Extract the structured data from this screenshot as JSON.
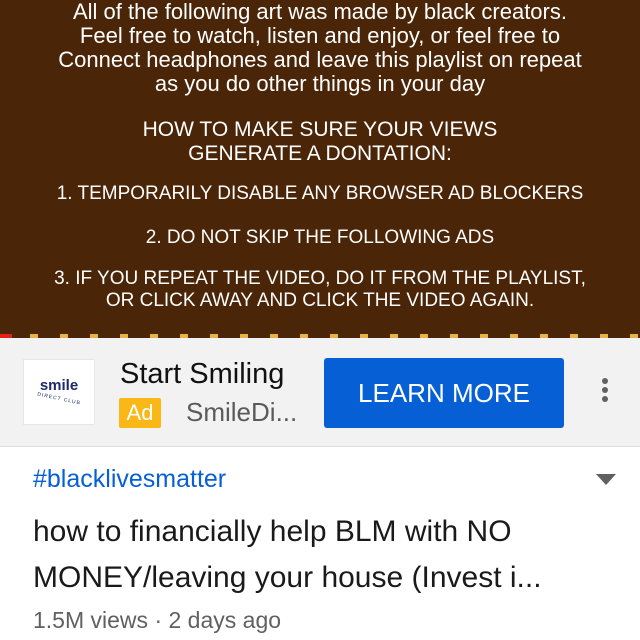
{
  "video": {
    "intro_lines": [
      "All of the following art was made by black creators.",
      "Feel free to watch, listen and enjoy, or feel free to",
      "Connect headphones and leave this playlist on repeat",
      "as you do other things in your day"
    ],
    "howto_lines": [
      "HOW TO MAKE SURE YOUR VIEWS",
      "GENERATE A DONTATION:"
    ],
    "step1": "1. TEMPORARILY DISABLE ANY BROWSER AD BLOCKERS",
    "step2": "2. DO NOT SKIP THE FOLLOWING ADS",
    "step3_lines": [
      "3. IF YOU REPEAT THE VIDEO, DO IT FROM THE PLAYLIST,",
      "OR CLICK AWAY AND CLICK THE VIDEO AGAIN."
    ],
    "background_color": "#4b2508",
    "ad_marker_color": "#e8b341"
  },
  "ad": {
    "logo_word": "smile",
    "logo_sub": "DIRECT CLUB",
    "title": "Start Smiling",
    "badge": "Ad",
    "domain": "SmileDi...",
    "cta": "LEARN MORE",
    "menu_icon": "more-vert-icon",
    "cta_color": "#065fd4",
    "badge_color": "#f9b818"
  },
  "info": {
    "hashtag": "#blacklivesmatter",
    "expand_icon": "chevron-down-icon",
    "title_lines": [
      "how to financially help BLM with NO",
      "MONEY/leaving your house (Invest i..."
    ],
    "views": "1.5M views",
    "separator": "·",
    "age": "2 days ago"
  }
}
